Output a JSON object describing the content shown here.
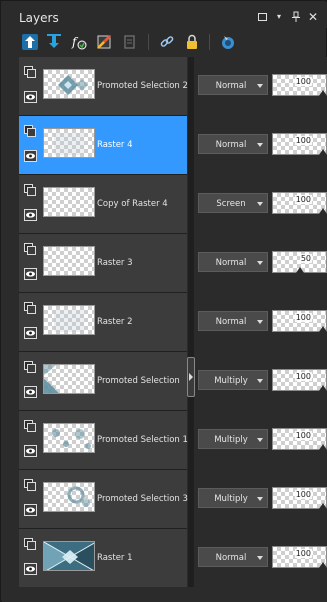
{
  "window": {
    "title": "Layers",
    "controls": [
      "restore-icon",
      "dropdown-icon",
      "pin-icon",
      "close-icon"
    ]
  },
  "toolbar": {
    "buttons": [
      {
        "name": "new-raster-layer-icon",
        "color": "#29a3e0"
      },
      {
        "name": "new-mask-layer-icon",
        "color": "#29a3e0"
      },
      {
        "name": "new-adjustment-layer-icon",
        "color": "#ffffff"
      },
      {
        "name": "effects-layer-icon",
        "color": "#e05a3a"
      },
      {
        "name": "layer-properties-icon",
        "color": "#6d6d6d"
      },
      {
        "name": "link-icon",
        "color": "#a0c8f0"
      },
      {
        "name": "lock-icon",
        "color": "#f0c030"
      },
      {
        "name": "view-options-icon",
        "color": "#3a8fd0"
      }
    ]
  },
  "layers": [
    {
      "name": "Promoted Selection 2",
      "blend_mode": "Normal",
      "opacity": 100,
      "selected": false,
      "thumb": "diamond"
    },
    {
      "name": "Raster 4",
      "blend_mode": "Normal",
      "opacity": 100,
      "selected": true,
      "thumb": "faint"
    },
    {
      "name": "Copy of Raster 4",
      "blend_mode": "Screen",
      "opacity": 100,
      "selected": false,
      "thumb": "empty"
    },
    {
      "name": "Raster 3",
      "blend_mode": "Normal",
      "opacity": 50,
      "selected": false,
      "thumb": "empty"
    },
    {
      "name": "Raster 2",
      "blend_mode": "Normal",
      "opacity": 100,
      "selected": false,
      "thumb": "faint"
    },
    {
      "name": "Promoted Selection",
      "blend_mode": "Multiply",
      "opacity": 100,
      "selected": false,
      "thumb": "corner"
    },
    {
      "name": "Promoted Selection 1",
      "blend_mode": "Multiply",
      "opacity": 100,
      "selected": false,
      "thumb": "spots"
    },
    {
      "name": "Promoted Selection 3",
      "blend_mode": "Multiply",
      "opacity": 100,
      "selected": false,
      "thumb": "rings"
    },
    {
      "name": "Raster 1",
      "blend_mode": "Normal",
      "opacity": 100,
      "selected": false,
      "thumb": "full"
    }
  ],
  "colors": {
    "selected_row": "#3399ff",
    "row_bg": "#3c3c3c",
    "panel_bg": "#2b2b2b",
    "thumb_accent": "#5f8fa0"
  }
}
